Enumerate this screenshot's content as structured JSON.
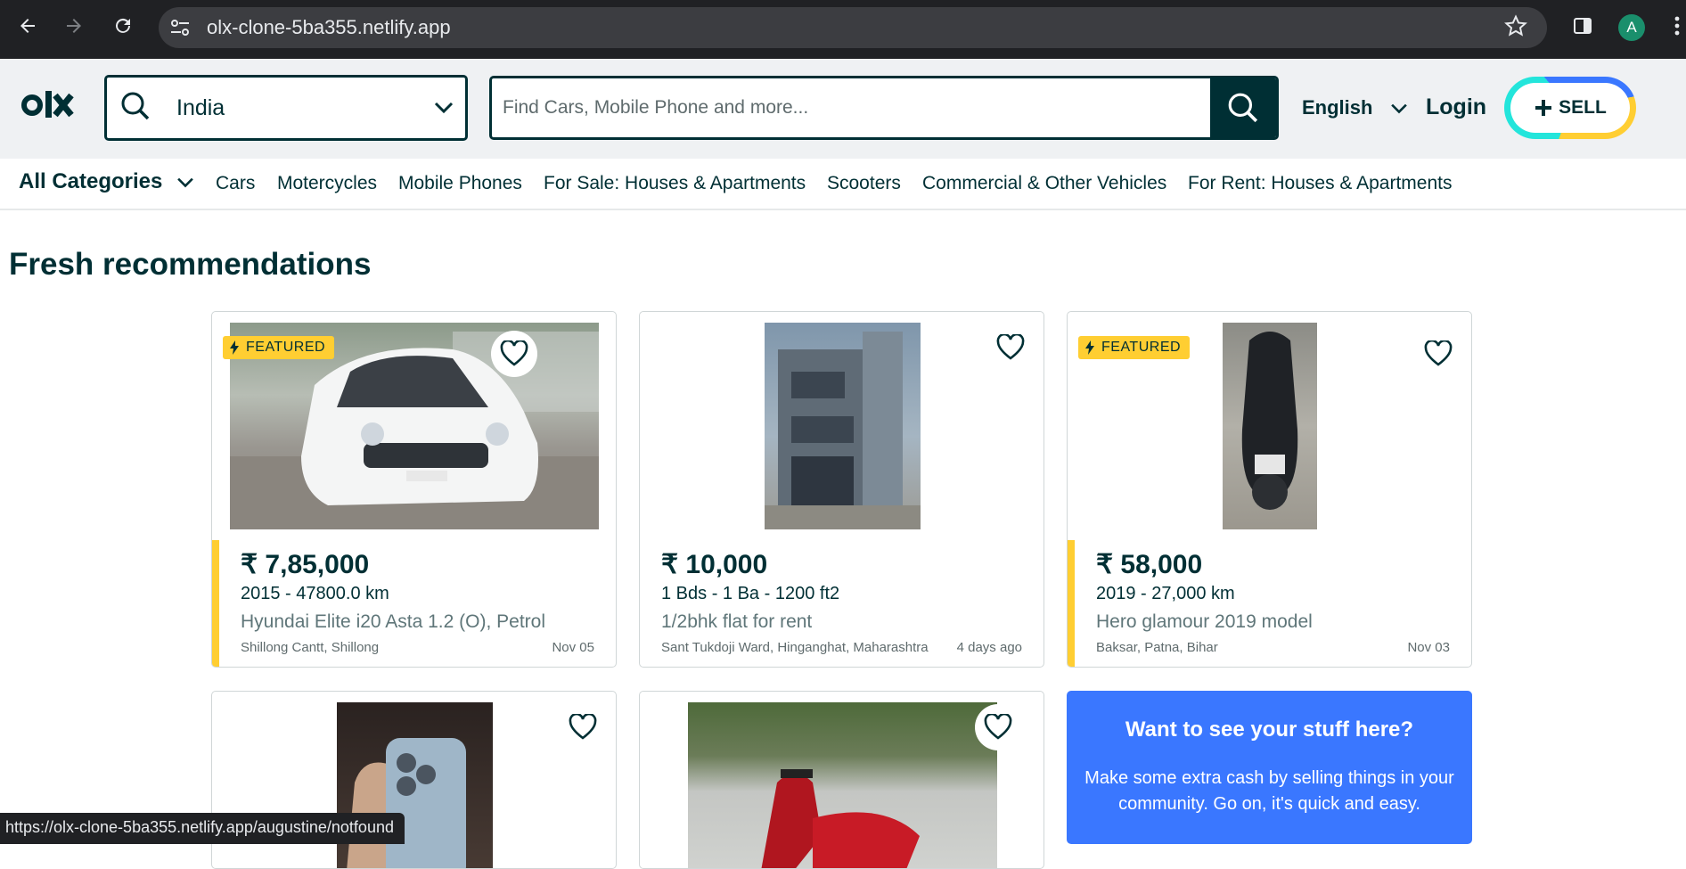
{
  "browser": {
    "url": "olx-clone-5ba355.netlify.app",
    "avatar_letter": "A",
    "status_url": "https://olx-clone-5ba355.netlify.app/augustine/notfound"
  },
  "header": {
    "location": "India",
    "search_placeholder": "Find Cars, Mobile Phone and more...",
    "language": "English",
    "login": "Login",
    "sell": "SELL"
  },
  "categories": {
    "all": "All Categories",
    "items": [
      "Cars",
      "Motercycles",
      "Mobile Phones",
      "For Sale: Houses & Apartments",
      "Scooters",
      "Commercial & Other Vehicles",
      "For Rent: Houses & Apartments"
    ]
  },
  "main": {
    "title": "Fresh recommendations",
    "featured_label": "FEATURED",
    "listings": [
      {
        "price": "₹ 7,85,000",
        "subtitle": "2015 - 47800.0 km",
        "title": "Hyundai Elite i20 Asta 1.2 (O), Petrol",
        "location": "Shillong Cantt, Shillong",
        "date": "Nov 05",
        "featured": true
      },
      {
        "price": "₹ 10,000",
        "subtitle": "1 Bds - 1 Ba - 1200 ft2",
        "title": "1/2bhk flat for rent",
        "location": "Sant Tukdoji Ward, Hinganghat, Maharashtra",
        "date": "4 days ago",
        "featured": false
      },
      {
        "price": "₹ 58,000",
        "subtitle": "2019 - 27,000 km",
        "title": "Hero glamour 2019 model",
        "location": "Baksar, Patna, Bihar",
        "date": "Nov 03",
        "featured": true
      }
    ],
    "promo": {
      "heading": "Want to see your stuff here?",
      "text": "Make some extra cash by selling things in your community. Go on, it's quick and easy."
    }
  },
  "colors": {
    "brand_dark": "#002f34",
    "featured_yellow": "#ffce32",
    "promo_blue": "#3a77ff",
    "sell_teal": "#23e5db"
  }
}
